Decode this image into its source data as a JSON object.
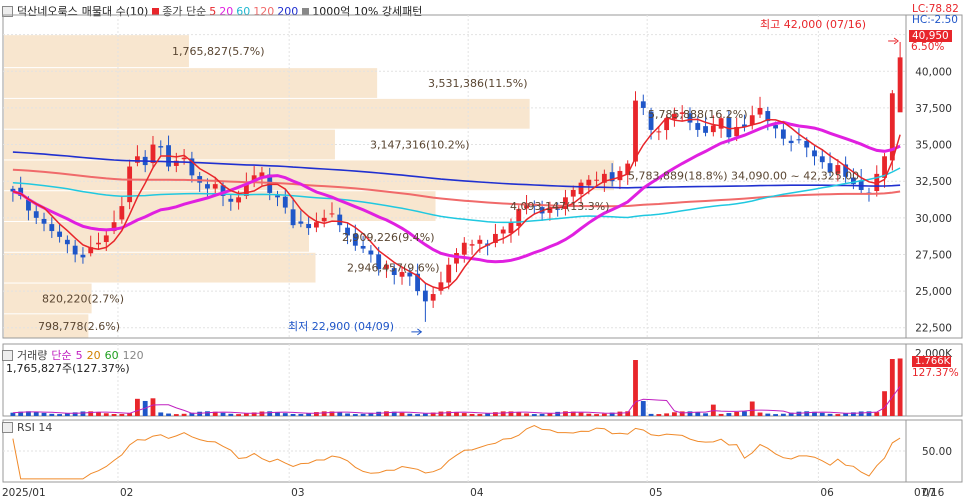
{
  "header": {
    "stock": "덕산네오룩스",
    "qty": "매물대 수(10)",
    "ma_label": "종가 단순",
    "ma_periods": [
      "5",
      "20",
      "60",
      "120",
      "200"
    ],
    "ma_colors": [
      "#e8262b",
      "#e020e0",
      "#20c8e0",
      "#f06a6a",
      "#2030d0"
    ],
    "pattern": "1000억 10% 강세패턴",
    "lc": "LC:78.82",
    "hc": "HC:-2.50",
    "price_badge": "40,950",
    "pct_badge": "6.50%"
  },
  "volume_header": {
    "title": "거래량",
    "ma_label": "단순",
    "ma_periods": [
      "5",
      "20",
      "60",
      "120"
    ],
    "value": "1,765,827주(127.37%)",
    "badge_value": "1.766K",
    "badge_pct": "127.37%"
  },
  "rsi_header": {
    "title": "RSI 14"
  },
  "annotations": {
    "high": "최고 42,000 (07/16)",
    "low": "최저 22,900 (04/09)"
  },
  "chart_data": [
    {
      "type": "candlestick",
      "name": "price",
      "ylim": [
        21800,
        43500
      ],
      "yticks": [
        "42,500",
        "40,000",
        "37,500",
        "35,000",
        "32,500",
        "30,000",
        "27,500",
        "25,000",
        "22,500"
      ],
      "ytick_values": [
        42500,
        40000,
        37500,
        35000,
        32500,
        30000,
        27500,
        25000,
        22500
      ],
      "volume_profile": [
        {
          "low": 40250,
          "high": 42500,
          "label": "1,765,827(5.7%)"
        },
        {
          "low": 38150,
          "high": 40250,
          "label": "3,531,386(11.5%)"
        },
        {
          "low": 36050,
          "high": 38150,
          "label": "5,785,888(16.2%)"
        },
        {
          "low": 33950,
          "high": 36050,
          "label": "3,147,316(10.2%)"
        },
        {
          "low": 31850,
          "high": 33950,
          "label": "5,783,889(18.8%) 34,090.00 ~ 42,325.00"
        },
        {
          "low": 29750,
          "high": 31850,
          "label": "4,093,147(13.3%)"
        },
        {
          "low": 27650,
          "high": 29750,
          "label": "2,909,226(9.4%)"
        },
        {
          "low": 25550,
          "high": 27650,
          "label": "2,946,457(9.6%)"
        },
        {
          "low": 23450,
          "high": 25550,
          "label": "820,220(2.7%)"
        },
        {
          "low": 21800,
          "high": 23450,
          "label": "798,778(2.6%)"
        }
      ],
      "closes": [
        31800,
        31500,
        30500,
        30000,
        29600,
        29100,
        28700,
        28200,
        27500,
        27300,
        28000,
        28300,
        28800,
        29700,
        30800,
        33500,
        34200,
        33600,
        35000,
        34800,
        33500,
        33900,
        34100,
        32900,
        32400,
        32000,
        32300,
        31500,
        31100,
        31400,
        32300,
        32900,
        33100,
        31700,
        31400,
        30700,
        29500,
        29600,
        29300,
        29700,
        30000,
        30300,
        29500,
        28800,
        28100,
        27900,
        27500,
        26500,
        26800,
        26100,
        26300,
        26000,
        25000,
        24300,
        24800,
        25600,
        26800,
        27600,
        28300,
        28200,
        28500,
        28100,
        28900,
        29200,
        29700,
        30600,
        31000,
        30800,
        30300,
        30700,
        30600,
        31400,
        31900,
        32400,
        32600,
        32600,
        33000,
        32500,
        33200,
        33700,
        38000,
        37500,
        36000,
        35900,
        36800,
        37100,
        37200,
        36500,
        36000,
        35800,
        36300,
        36800,
        35500,
        36200,
        36200,
        37000,
        37500,
        36600,
        36100,
        35400,
        35100,
        35300,
        34800,
        34200,
        33800,
        33100,
        33600,
        32800,
        32300,
        31900,
        31700,
        33000,
        34200,
        38500,
        40950
      ],
      "volume_label_pct": [
        0.06
      ],
      "high": {
        "value": 42000,
        "date": "07/16"
      },
      "low": {
        "value": 22900,
        "date": "04/09"
      },
      "ma5_color": "#e8262b",
      "ma20_color": "#e020e0",
      "ma60_color": "#20c8e0",
      "ma120_color": "#f06a6a",
      "ma200_color": "#2030d0"
    },
    {
      "type": "bar",
      "name": "volume",
      "ytick": "2,000K",
      "ymax": 2000
    },
    {
      "type": "line",
      "name": "rsi",
      "ylim": [
        0,
        100
      ],
      "ytick": "50.00",
      "ytick_value": 50
    }
  ],
  "x_axis": {
    "labels": [
      "2025/01",
      "02",
      "03",
      "04",
      "05",
      "06",
      "07",
      "07/16"
    ]
  },
  "colors": {
    "up": "#e8262b",
    "down": "#1f56c8",
    "profile": "#f8e6cf",
    "rsi": "#f08a2a",
    "grid": "#e2e2e2"
  }
}
